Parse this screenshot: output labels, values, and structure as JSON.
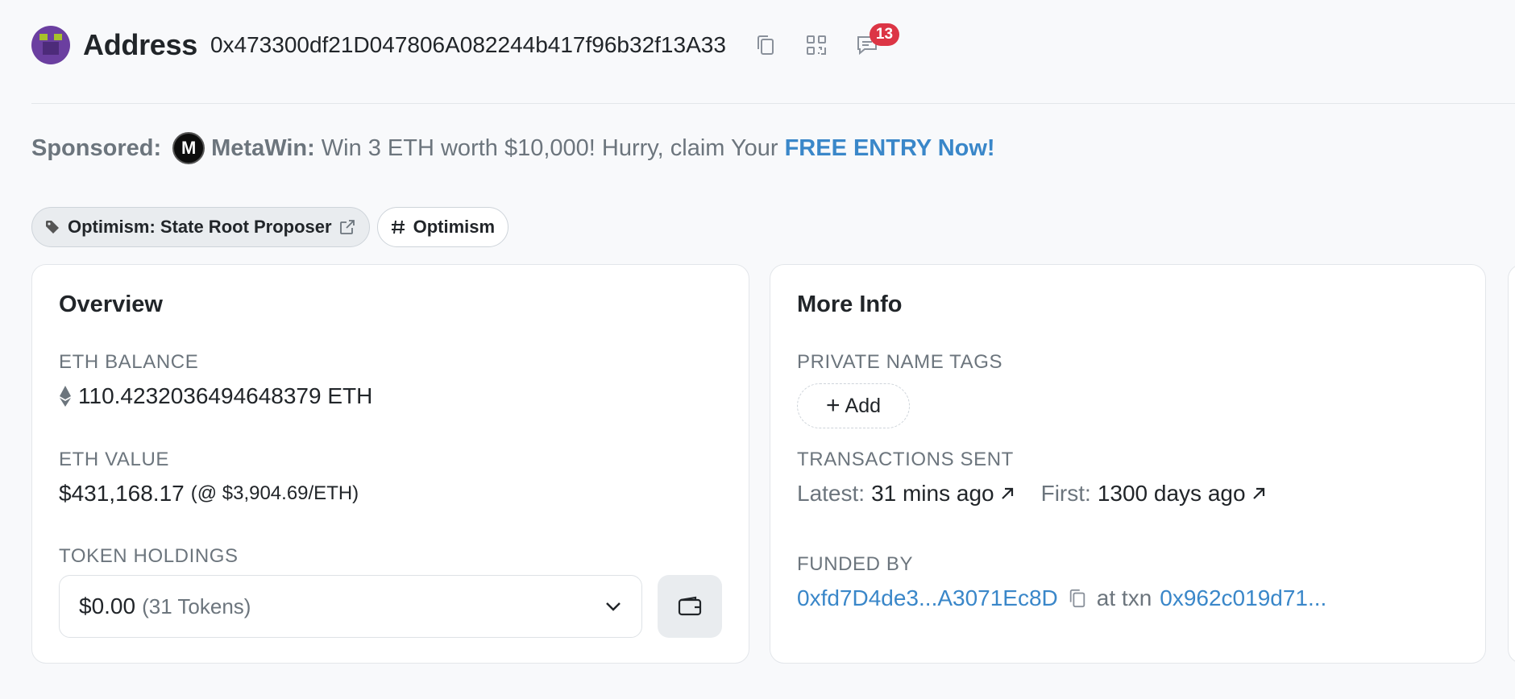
{
  "header": {
    "title": "Address",
    "address": "0x473300df21D047806A082244b417f96b32f13A33",
    "icons": {
      "copy": "copy-icon",
      "qr": "qr-code-icon",
      "comments": "comment-icon"
    },
    "comment_count": "13"
  },
  "sponsored": {
    "label": "Sponsored:",
    "brand": "MetaWin:",
    "text": "Win 3 ETH worth $10,000! Hurry, claim Your",
    "cta": "FREE ENTRY Now!"
  },
  "tags": [
    {
      "label": "Optimism: State Root Proposer",
      "icon": "tag-icon"
    },
    {
      "label": "Optimism",
      "icon": "hash-icon"
    }
  ],
  "overview": {
    "title": "Overview",
    "eth_balance_label": "ETH BALANCE",
    "eth_balance": "110.4232036494648379 ETH",
    "eth_value_label": "ETH VALUE",
    "eth_value": "$431,168.17",
    "eth_price": "(@ $3,904.69/ETH)",
    "token_holdings_label": "TOKEN HOLDINGS",
    "token_value": "$0.00",
    "token_count": "(31 Tokens)"
  },
  "more_info": {
    "title": "More Info",
    "private_tags_label": "PRIVATE NAME TAGS",
    "add_label": "Add",
    "tx_sent_label": "TRANSACTIONS SENT",
    "latest_label": "Latest:",
    "latest_value": "31 mins ago",
    "first_label": "First:",
    "first_value": "1300 days ago",
    "funded_by_label": "FUNDED BY",
    "funded_by_address": "0xfd7D4de3...A3071Ec8D",
    "at_txn_label": "at txn",
    "funded_txn": "0x962c019d71..."
  },
  "colors": {
    "link": "#3a87c9",
    "badge": "#dc3545",
    "avatar": "#6b3fa0"
  }
}
